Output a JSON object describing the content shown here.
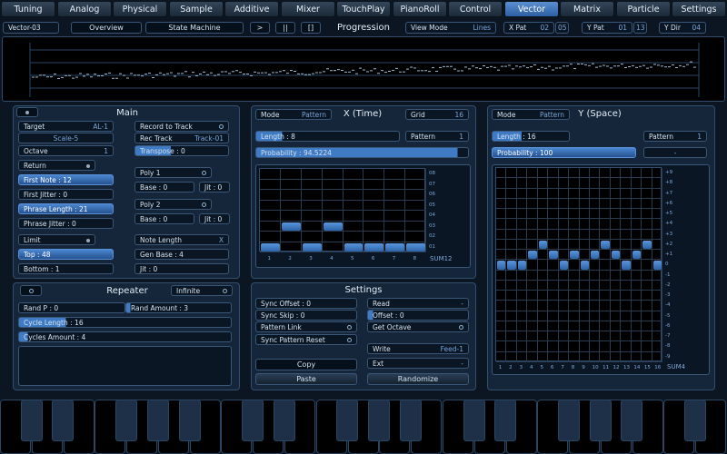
{
  "tabs": [
    {
      "label": "Tuning"
    },
    {
      "label": "Analog"
    },
    {
      "label": "Physical"
    },
    {
      "label": "Sample"
    },
    {
      "label": "Additive"
    },
    {
      "label": "Mixer"
    },
    {
      "label": "TouchPlay"
    },
    {
      "label": "PianoRoll"
    },
    {
      "label": "Control"
    },
    {
      "label": "Vector"
    },
    {
      "label": "Matrix"
    },
    {
      "label": "Particle"
    },
    {
      "label": "Settings"
    }
  ],
  "active_tab": "Vector",
  "toolbar": {
    "preset": "Vector-03",
    "overview": "Overview",
    "state_machine": "State Machine",
    "play": ">",
    "pause": "||",
    "stop": "[]",
    "progression": "Progression",
    "view_mode_label": "View Mode",
    "view_mode_value": "Lines",
    "x_pat_label": "X Pat",
    "x_pat_value": "02",
    "x_pat_count": "05",
    "y_pat_label": "Y Pat",
    "y_pat_value": "01",
    "y_pat_count": "13",
    "y_dir_label": "Y Dir",
    "y_dir_value": "04"
  },
  "main": {
    "title": "Main",
    "target_label": "Target",
    "target_value": "AL-1",
    "scale": "Scale-5",
    "octave_label": "Octave",
    "octave_value": "1",
    "return": "Return",
    "first_note": "First Note : 12",
    "first_jitter": "First Jitter : 0",
    "phrase_length": "Phrase Length : 21",
    "phrase_jitter": "Phrase Jitter : 0",
    "limit": "Limit",
    "top": "Top : 48",
    "bottom": "Bottom : 1",
    "record_to_track": "Record to Track",
    "rec_track_label": "Rec Track",
    "rec_track_value": "Track-01",
    "transpose": "Transpose : 0",
    "poly1": "Poly 1",
    "poly1_base": "Base : 0",
    "poly1_jit": "Jit : 0",
    "poly2": "Poly 2",
    "poly2_base": "Base : 0",
    "poly2_jit": "Jit : 0",
    "note_length_label": "Note Length",
    "note_length_value": "X",
    "gen_base": "Gen Base : 4",
    "jit": "Jit : 0"
  },
  "repeater": {
    "title": "Repeater",
    "mode": "Infinite",
    "rand_p": "Rand P : 0",
    "rand_amount": "Rand Amount : 3",
    "cycle_length": "Cycle Length : 16",
    "cycles_amount": "Cycles Amount : 4"
  },
  "x_panel": {
    "mode_label": "Mode",
    "mode_value": "Pattern",
    "title": "X (Time)",
    "grid_label": "Grid",
    "grid_value": "16",
    "length": "Length : 8",
    "pattern_label": "Pattern",
    "pattern_value": "1",
    "probability": "Probability : 94.5224",
    "probability_fraction": 0.945,
    "row_labels": [
      "08",
      "07",
      "06",
      "05",
      "04",
      "03",
      "02",
      "01"
    ],
    "col_labels": [
      "1",
      "2",
      "3",
      "4",
      "5",
      "6",
      "7",
      "8"
    ],
    "sum": "SUM12",
    "steps": [
      1,
      3,
      1,
      3,
      1,
      1,
      1,
      1
    ]
  },
  "y_panel": {
    "mode_label": "Mode",
    "mode_value": "Pattern",
    "title": "Y (Space)",
    "length": "Length : 16",
    "pattern_label": "Pattern",
    "pattern_value": "1",
    "probability": "Probability : 100",
    "minus": "-",
    "row_labels": [
      "+9",
      "+8",
      "+7",
      "+6",
      "+5",
      "+4",
      "+3",
      "+2",
      "+1",
      "0",
      "-1",
      "-2",
      "-3",
      "-4",
      "-5",
      "-6",
      "-7",
      "-8",
      "-9"
    ],
    "col_labels": [
      "1",
      "2",
      "3",
      "4",
      "5",
      "6",
      "7",
      "8",
      "9",
      "10",
      "11",
      "12",
      "13",
      "14",
      "15",
      "16"
    ],
    "sum": "SUM4",
    "steps": [
      0,
      0,
      0,
      1,
      2,
      1,
      0,
      1,
      0,
      1,
      2,
      1,
      0,
      1,
      2,
      0
    ]
  },
  "settings": {
    "title": "Settings",
    "sync_offset": "Sync Offset : 0",
    "sync_skip": "Sync Skip : 0",
    "pattern_link": "Pattern Link",
    "sync_pattern_reset": "Sync Pattern Reset",
    "read_label": "Read",
    "read_value": "-",
    "offset": "Offset : 0",
    "get_octave": "Get Octave",
    "write_label": "Write",
    "write_value": "Feed-1",
    "ext_label": "Ext",
    "ext_value": "-",
    "copy": "Copy",
    "paste": "Paste",
    "randomize": "Randomize"
  }
}
